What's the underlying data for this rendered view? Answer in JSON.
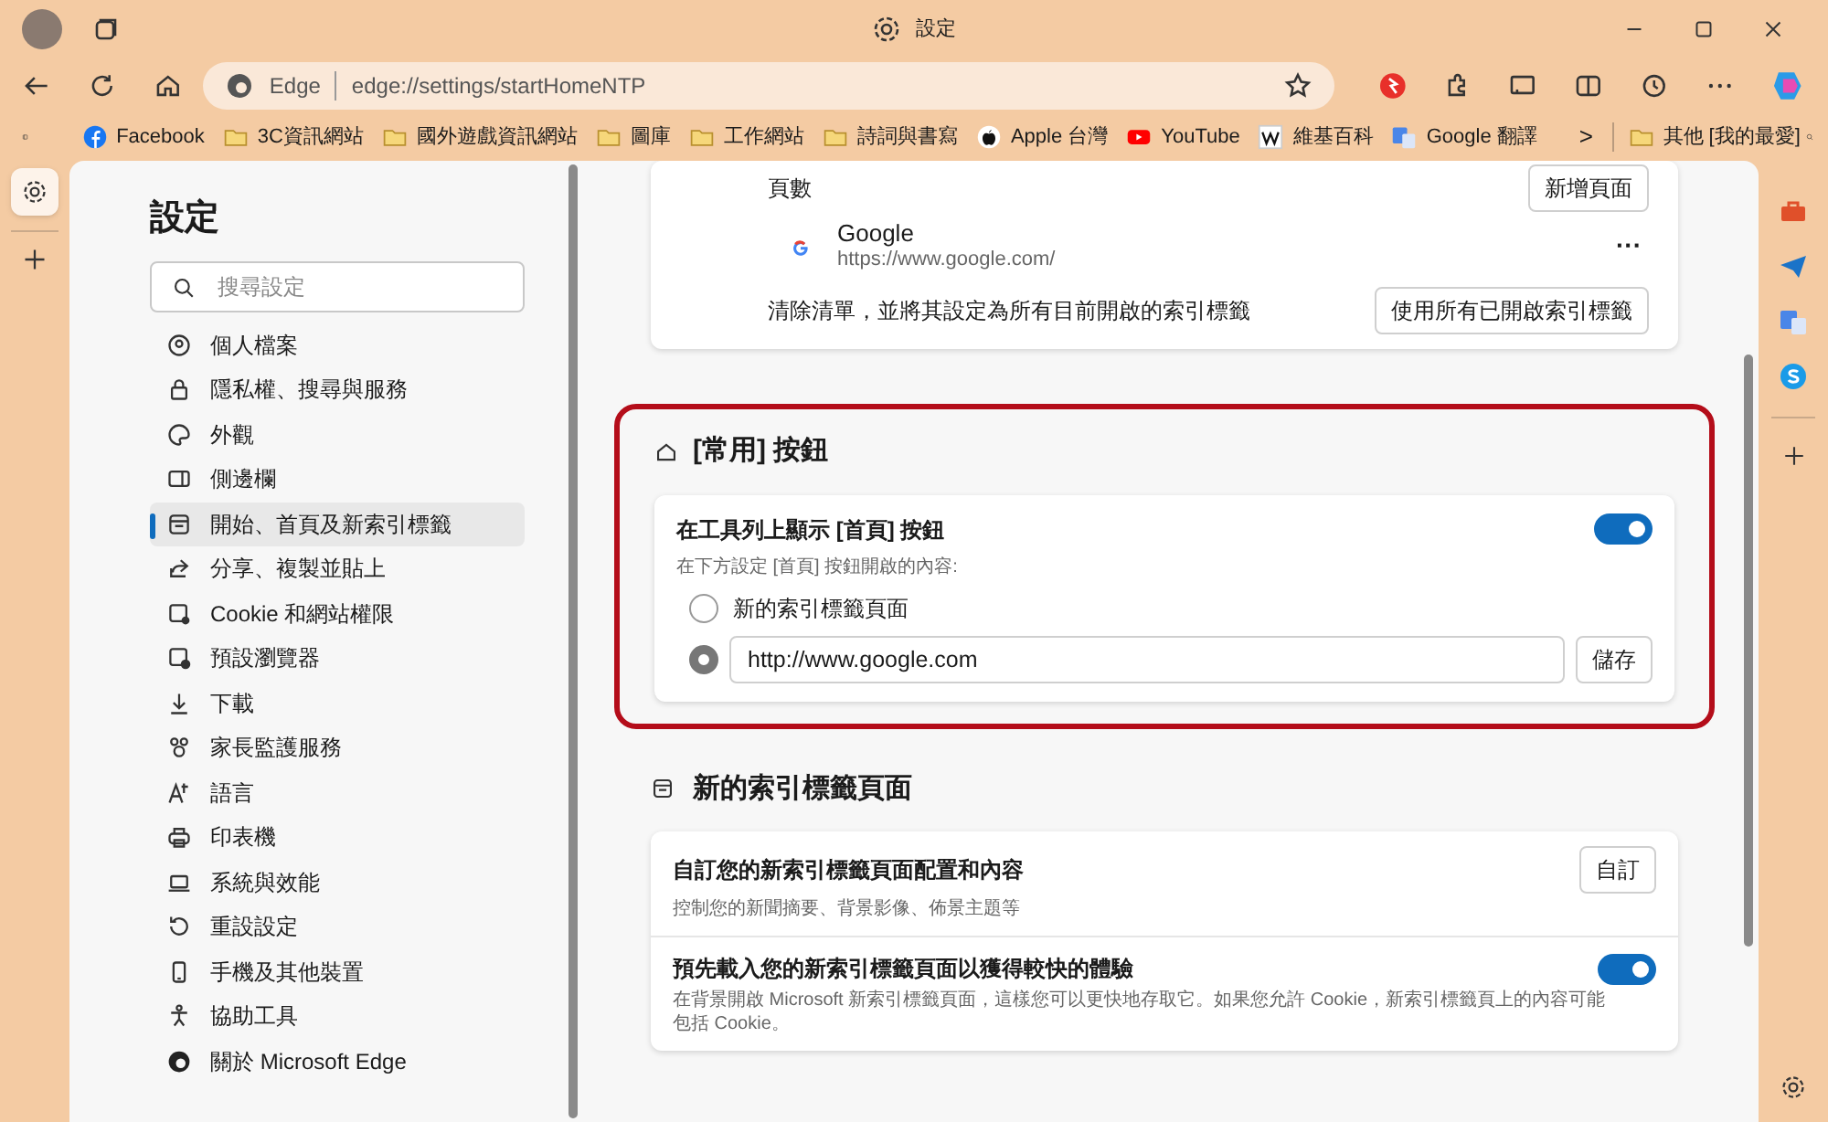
{
  "window": {
    "title": "設定"
  },
  "address_bar": {
    "brand": "Edge",
    "url": "edge://settings/startHomeNTP"
  },
  "bookmarks": [
    {
      "label": "Facebook",
      "kind": "facebook"
    },
    {
      "label": "3C資訊網站",
      "kind": "folder"
    },
    {
      "label": "國外遊戲資訊網站",
      "kind": "folder"
    },
    {
      "label": "圖庫",
      "kind": "folder"
    },
    {
      "label": "工作網站",
      "kind": "folder"
    },
    {
      "label": "詩詞與書寫",
      "kind": "folder"
    },
    {
      "label": "Apple 台灣",
      "kind": "apple"
    },
    {
      "label": "YouTube",
      "kind": "youtube"
    },
    {
      "label": "維基百科",
      "kind": "wiki"
    },
    {
      "label": "Google 翻譯",
      "kind": "translate"
    }
  ],
  "bookmarks_overflow": {
    "arrow": ">",
    "label": "其他 [我的最愛]"
  },
  "settings_nav": {
    "title": "設定",
    "search_placeholder": "搜尋設定",
    "items": [
      {
        "label": "個人檔案",
        "selected": false
      },
      {
        "label": "隱私權、搜尋與服務",
        "selected": false
      },
      {
        "label": "外觀",
        "selected": false
      },
      {
        "label": "側邊欄",
        "selected": false
      },
      {
        "label": "開始、首頁及新索引標籤",
        "selected": true
      },
      {
        "label": "分享、複製並貼上",
        "selected": false
      },
      {
        "label": "Cookie 和網站權限",
        "selected": false
      },
      {
        "label": "預設瀏覽器",
        "selected": false
      },
      {
        "label": "下載",
        "selected": false
      },
      {
        "label": "家長監護服務",
        "selected": false
      },
      {
        "label": "語言",
        "selected": false
      },
      {
        "label": "印表機",
        "selected": false
      },
      {
        "label": "系統與效能",
        "selected": false
      },
      {
        "label": "重設設定",
        "selected": false
      },
      {
        "label": "手機及其他裝置",
        "selected": false
      },
      {
        "label": "協助工具",
        "selected": false
      },
      {
        "label": "關於 Microsoft Edge",
        "selected": false
      }
    ]
  },
  "startup_card": {
    "header": "頁數",
    "add_button": "新增頁面",
    "page": {
      "name": "Google",
      "url": "https://www.google.com/",
      "menu": "···"
    },
    "clear_text": "清除清單，並將其設定為所有目前開啟的索引標籤",
    "use_tabs_button": "使用所有已開啟索引標籤"
  },
  "home_section": {
    "title": "[常用] 按鈕",
    "highlighted": true,
    "toggle": {
      "label": "在工具列上顯示 [首頁] 按鈕",
      "description": "在下方設定 [首頁] 按鈕開啟的內容:",
      "on": true
    },
    "options": [
      {
        "kind": "radio",
        "label": "新的索引標籤頁面",
        "selected": false
      },
      {
        "kind": "url",
        "value": "http://www.google.com",
        "selected": true
      }
    ],
    "save_button": "儲存"
  },
  "ntp_section": {
    "title": "新的索引標籤頁面",
    "rows": [
      {
        "kind": "button",
        "title": "自訂您的新索引標籤頁面配置和內容",
        "description": "控制您的新聞摘要、背景影像、佈景主題等",
        "button": "自訂"
      },
      {
        "kind": "toggle",
        "title": "預先載入您的新索引標籤頁面以獲得較快的體驗",
        "description": "在背景開啟 Microsoft 新索引標籤頁面，這樣您可以更快地存取它。如果您允許 Cookie，新索引標籤頁上的內容可能包括 Cookie。",
        "on": true
      }
    ]
  }
}
